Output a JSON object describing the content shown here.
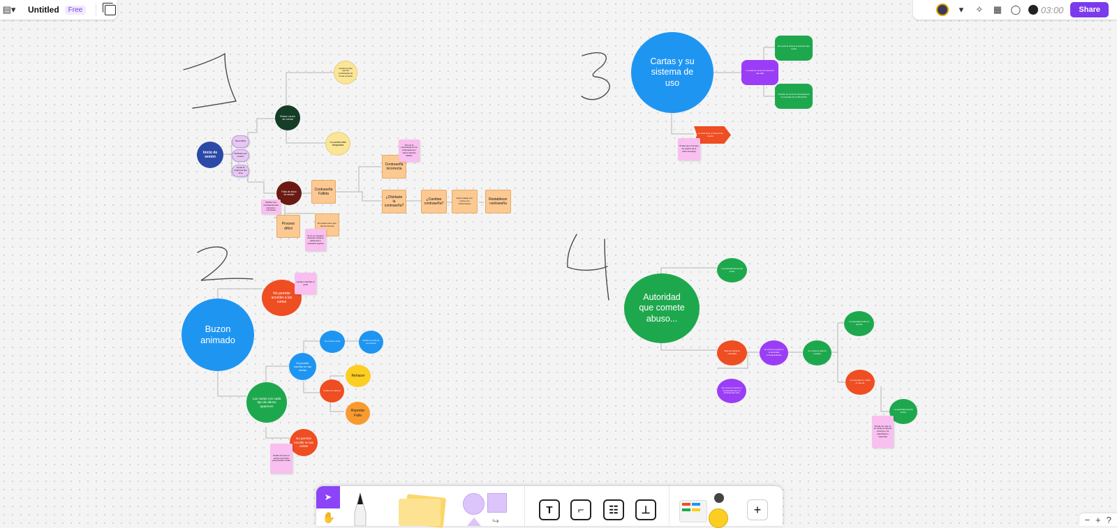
{
  "app": {
    "title": "Untitled",
    "plan_badge": "Free"
  },
  "header": {
    "timer": "03:00",
    "share_label": "Share"
  },
  "board": {
    "number_1": "1",
    "number_2": "2",
    "number_3": "3",
    "number_4": "4",
    "map1": {
      "root": "Inicio de sesion",
      "opt_a": "Nivel Difícil",
      "opt_b": "Olvidaste que usuario",
      "opt_c": "Ayuda al programa que sirve",
      "upper_branch": "Enlace correo de cuenta",
      "upper_leaf_1": "Usuario perdió que las contraseñas de forma correcta",
      "upper_leaf_2": "La cuenta está bloqueada",
      "lower_branch": "Falla de inicio de sesión",
      "note_left": "Olvidar si la contraseña esta correcta o incorrecta",
      "proceso": "Proceso difícil",
      "wrong_password": "Contraseña Fallida",
      "help_box": "El usuario tiene que dar la correcta",
      "note_bottom": "Si no se resuelve después requiere asistencia o contactar soporte",
      "incorrect_password": "Contraseña incorrecta",
      "note_top": "Tal vez la contraseña se ha bloqueado por varios intentos fallidos",
      "forgot_password": "¿Olvidaste la contraseña?",
      "change_password": "¿Cambiar contraseña?",
      "send_code": "Envió código a tu correo con instrucciones",
      "reset_password": "Restablecer contraseña"
    },
    "map2": {
      "root": "Buzon animado",
      "top_branch": "No permite acceder a las cartas",
      "top_note": "Ayuda a cambiar el perfil",
      "lower_branch": "Las cartas con cada tipo de abuso aparecen",
      "sub_blue": "El permite escribir en las cartas",
      "blue_leaf_1": "Se envía la carta",
      "blue_leaf_2": "Recibe la carta de la persona",
      "sub_red": "Cartas con abusos",
      "rehacer": "Rehacer",
      "reportar": "Reportar Falla",
      "bottom_red": "No permite escribir en las cartas",
      "bottom_note": "Puede ser que no tenga el permiso para escribir cartas"
    },
    "map3": {
      "root": "Cartas y su sistema de uso",
      "purple_node": "La carta se envía a la persona que elija",
      "green_top": "Se envía la carta a la persona que recibe",
      "green_bottom": "Cuando se envíe la carta aparece un mensaje de confirmación",
      "arrow_label": "La carta tiene un tiempo de espera",
      "note": "Puede que el tiempo de espera de la carta sea largo"
    },
    "map4": {
      "root": "Autoridad que comete abuso...",
      "top_green": "La autoridad abusa del poder",
      "red_node": "Reporte hacia la autoridad",
      "purple_node": "Se envía el reporte a la autoridad correspondiente",
      "purple_bottom": "Se envía un reporte a la autoridad que se encarga del caso",
      "green_mid": "Se revisa el reporte enviado",
      "green_right": "La autoridad recibe el reporte",
      "red_right": "La autoridad no recibe el reporte",
      "green_far": "La autoridad tomará acción",
      "note": "Puede ser que no se revise el reporte a tiempo o la autoridad no responda"
    }
  },
  "toolbar": {
    "add_label": "+"
  },
  "zoom": {
    "minus": "−",
    "plus": "+",
    "help": "?"
  },
  "colors": {
    "accent": "#7c3aed",
    "blue": "#1f95f2",
    "green": "#1ea84d",
    "red": "#ef4d22",
    "purple": "#9b3df6",
    "sticky_pink": "#f9bff0",
    "orange_box": "#fcc992",
    "yellow_circle": "#fbe597"
  }
}
